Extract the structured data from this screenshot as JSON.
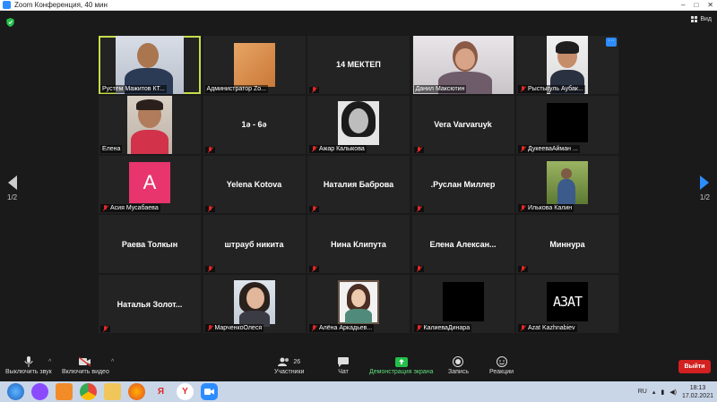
{
  "window": {
    "title": "Zoom Конференция, 40 мин",
    "controls": [
      "–",
      "□",
      "✕"
    ]
  },
  "view_label": "Вид",
  "pagination": {
    "left": "1/2",
    "right": "1/2"
  },
  "participants": [
    {
      "name": "Рустем Мажитов КТ...",
      "kind": "photo",
      "muted": false,
      "active": true
    },
    {
      "name": "Администратор Zo...",
      "kind": "photo-block",
      "muted": false
    },
    {
      "name": "14 МЕКТЕП",
      "kind": "text",
      "muted": true
    },
    {
      "name": "Данил Максютин",
      "kind": "photo",
      "muted": false
    },
    {
      "name": "Рыстыгуль Аубак...",
      "kind": "photo",
      "muted": true,
      "more": true
    },
    {
      "name": "Елена",
      "kind": "photo",
      "muted": false
    },
    {
      "name": "1ә - 6ә",
      "kind": "text",
      "muted": true
    },
    {
      "name": "Ажар Калыкова",
      "kind": "photo",
      "muted": true
    },
    {
      "name": "Vera Varvaruyk",
      "kind": "text",
      "muted": true
    },
    {
      "name": "ДукееваАйман ...",
      "kind": "black",
      "muted": true
    },
    {
      "name": "Асия Мусабаева",
      "kind": "avatar",
      "initial": "A",
      "muted": true
    },
    {
      "name": "Yelena Kotova",
      "kind": "text",
      "muted": true
    },
    {
      "name": "Наталия Баброва",
      "kind": "text",
      "muted": true
    },
    {
      "name": ".Руслан Миллер",
      "kind": "text",
      "muted": true
    },
    {
      "name": "Илькова Калин",
      "kind": "photo",
      "muted": true
    },
    {
      "name": "Раева Толкын",
      "kind": "text",
      "muted": false
    },
    {
      "name": "штрауб никита",
      "kind": "text",
      "muted": true
    },
    {
      "name": "Нина Клипута",
      "kind": "text",
      "muted": true
    },
    {
      "name": "Елена  Алексан...",
      "kind": "text",
      "muted": true
    },
    {
      "name": "Миннура",
      "kind": "text",
      "muted": true
    },
    {
      "name": "Наталья  Золот...",
      "kind": "text",
      "muted": true
    },
    {
      "name": "МарченкоОлеся",
      "kind": "photo",
      "muted": true
    },
    {
      "name": "Алёна Аркадьев...",
      "kind": "photo",
      "muted": true
    },
    {
      "name": "КалиеваДинара",
      "kind": "black",
      "muted": true
    },
    {
      "name": "Azat Kazhnabiev",
      "kind": "logo",
      "logo_text": "AЗAT",
      "muted": true
    }
  ],
  "toolbar": {
    "mute": "Выключить звук",
    "video": "Включить видео",
    "participants": "Участники",
    "participants_count": "26",
    "chat": "Чат",
    "share": "Демонстрация экрана",
    "record": "Запись",
    "reactions": "Реакции",
    "leave": "Выйти"
  },
  "taskbar": {
    "lang": "RU",
    "time": "18:13",
    "date": "17.02.2021",
    "apps": [
      "start-icon",
      "alice-icon",
      "media-icon",
      "chrome-icon",
      "folder-icon",
      "firefox-icon",
      "yandex-icon",
      "yandex-browser-icon",
      "zoom-icon"
    ]
  },
  "colors": {
    "accent": "#2d8cff",
    "active_speaker": "#c7dc4a",
    "leave": "#d32020",
    "share": "#23c04a",
    "mute": "#e02828"
  }
}
